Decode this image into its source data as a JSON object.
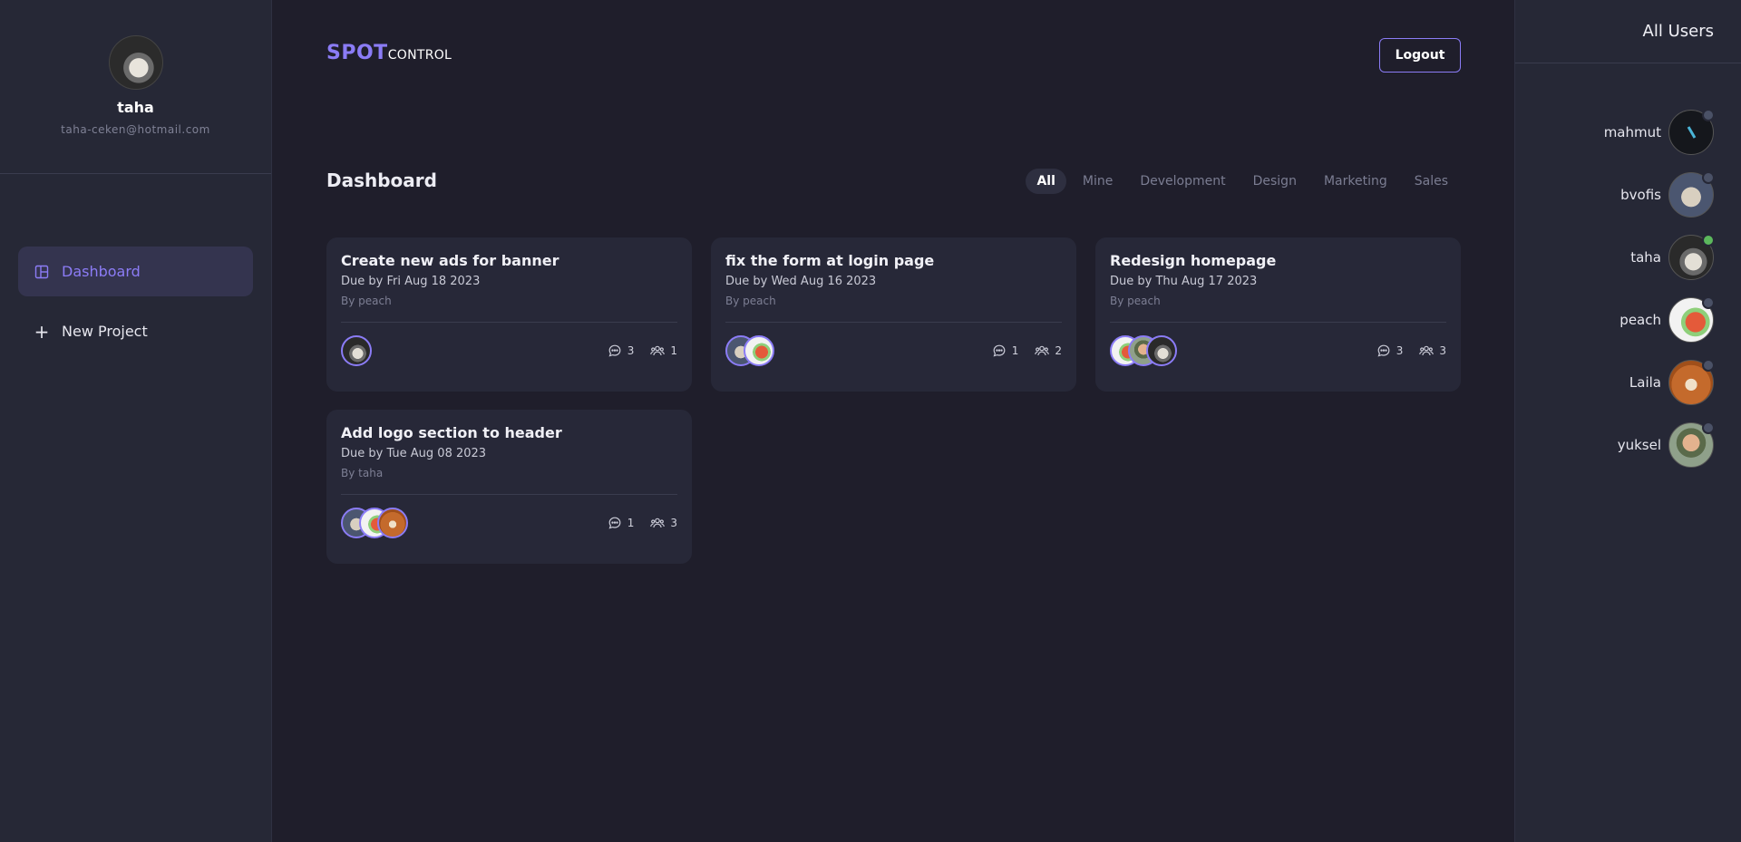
{
  "sidebar": {
    "profile": {
      "name": "taha",
      "email": "taha-ceken@hotmail.com"
    },
    "nav": [
      {
        "label": "Dashboard",
        "icon": "dashboard-icon",
        "active": true
      },
      {
        "label": "New Project",
        "icon": "plus-icon",
        "active": false
      }
    ]
  },
  "header": {
    "logo_a": "SPOT",
    "logo_b": "CONTROL",
    "logout_label": "Logout",
    "accent": "#8b7cf6"
  },
  "dashboard": {
    "title": "Dashboard",
    "filters": [
      "All",
      "Mine",
      "Development",
      "Design",
      "Marketing",
      "Sales"
    ],
    "active_filter": "All"
  },
  "projects": [
    {
      "title": "Create new ads for banner",
      "due": "Due by Fri Aug 18 2023",
      "by": "By peach",
      "comments": "3",
      "members": "1",
      "avatars": [
        "taha"
      ]
    },
    {
      "title": "fix the form at login page",
      "due": "Due by Wed Aug 16 2023",
      "by": "By peach",
      "comments": "1",
      "members": "2",
      "avatars": [
        "bvofis",
        "peach"
      ]
    },
    {
      "title": "Redesign homepage",
      "due": "Due by Thu Aug 17 2023",
      "by": "By peach",
      "comments": "3",
      "members": "3",
      "avatars": [
        "peach",
        "yuksel",
        "taha"
      ]
    },
    {
      "title": "Add logo section to header",
      "due": "Due by Tue Aug 08 2023",
      "by": "By taha",
      "comments": "1",
      "members": "3",
      "avatars": [
        "bvofis",
        "peach",
        "laila"
      ]
    }
  ],
  "users_panel": {
    "title": "All Users",
    "users": [
      {
        "name": "mahmut",
        "online": false
      },
      {
        "name": "bvofis",
        "online": false
      },
      {
        "name": "taha",
        "online": true
      },
      {
        "name": "peach",
        "online": false
      },
      {
        "name": "Laila",
        "online": false
      },
      {
        "name": "yuksel",
        "online": false
      }
    ]
  }
}
